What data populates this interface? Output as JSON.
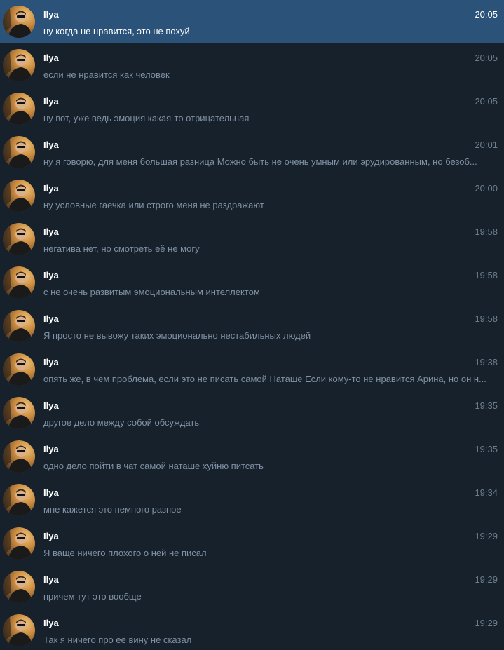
{
  "messages": [
    {
      "sender": "Ilya",
      "time": "20:05",
      "text": "ну когда не нравится, это не похуй",
      "selected": true
    },
    {
      "sender": "Ilya",
      "time": "20:05",
      "text": "если не нравится как человек",
      "selected": false
    },
    {
      "sender": "Ilya",
      "time": "20:05",
      "text": "ну вот, уже ведь эмоция какая-то отрицательная",
      "selected": false
    },
    {
      "sender": "Ilya",
      "time": "20:01",
      "text": "ну я говорю, для меня большая разница Можно быть не очень умным или эрудированным, но безоб...",
      "selected": false
    },
    {
      "sender": "Ilya",
      "time": "20:00",
      "text": "ну условные гаечка или строго меня не раздражают",
      "selected": false
    },
    {
      "sender": "Ilya",
      "time": "19:58",
      "text": "негатива нет, но смотреть её не могу",
      "selected": false
    },
    {
      "sender": "Ilya",
      "time": "19:58",
      "text": "с не очень развитым эмоциональным интеллектом",
      "selected": false
    },
    {
      "sender": "Ilya",
      "time": "19:58",
      "text": "Я просто не вывожу таких эмоционально нестабильных людей",
      "selected": false
    },
    {
      "sender": "Ilya",
      "time": "19:38",
      "text": "опять же, в чем проблема, если это не писать самой Наташе Если кому-то не нравится Арина, но он н...",
      "selected": false
    },
    {
      "sender": "Ilya",
      "time": "19:35",
      "text": "другое дело между собой обсуждать",
      "selected": false
    },
    {
      "sender": "Ilya",
      "time": "19:35",
      "text": "одно дело пойти в чат самой наташе хуйню питсать",
      "selected": false
    },
    {
      "sender": "Ilya",
      "time": "19:34",
      "text": "мне кажется это немного разное",
      "selected": false
    },
    {
      "sender": "Ilya",
      "time": "19:29",
      "text": "Я ваще ничего плохого о ней не писал",
      "selected": false
    },
    {
      "sender": "Ilya",
      "time": "19:29",
      "text": "причем тут это вообще",
      "selected": false
    },
    {
      "sender": "Ilya",
      "time": "19:29",
      "text": "Так я ничего про её вину не сказал",
      "selected": false
    }
  ],
  "colors": {
    "background": "#17212b",
    "selected_row": "#2b5278",
    "name": "#ffffff",
    "time": "#6d7f8f",
    "text": "#7f91a4"
  },
  "icons": {
    "avatar": "user-photo-avatar"
  }
}
